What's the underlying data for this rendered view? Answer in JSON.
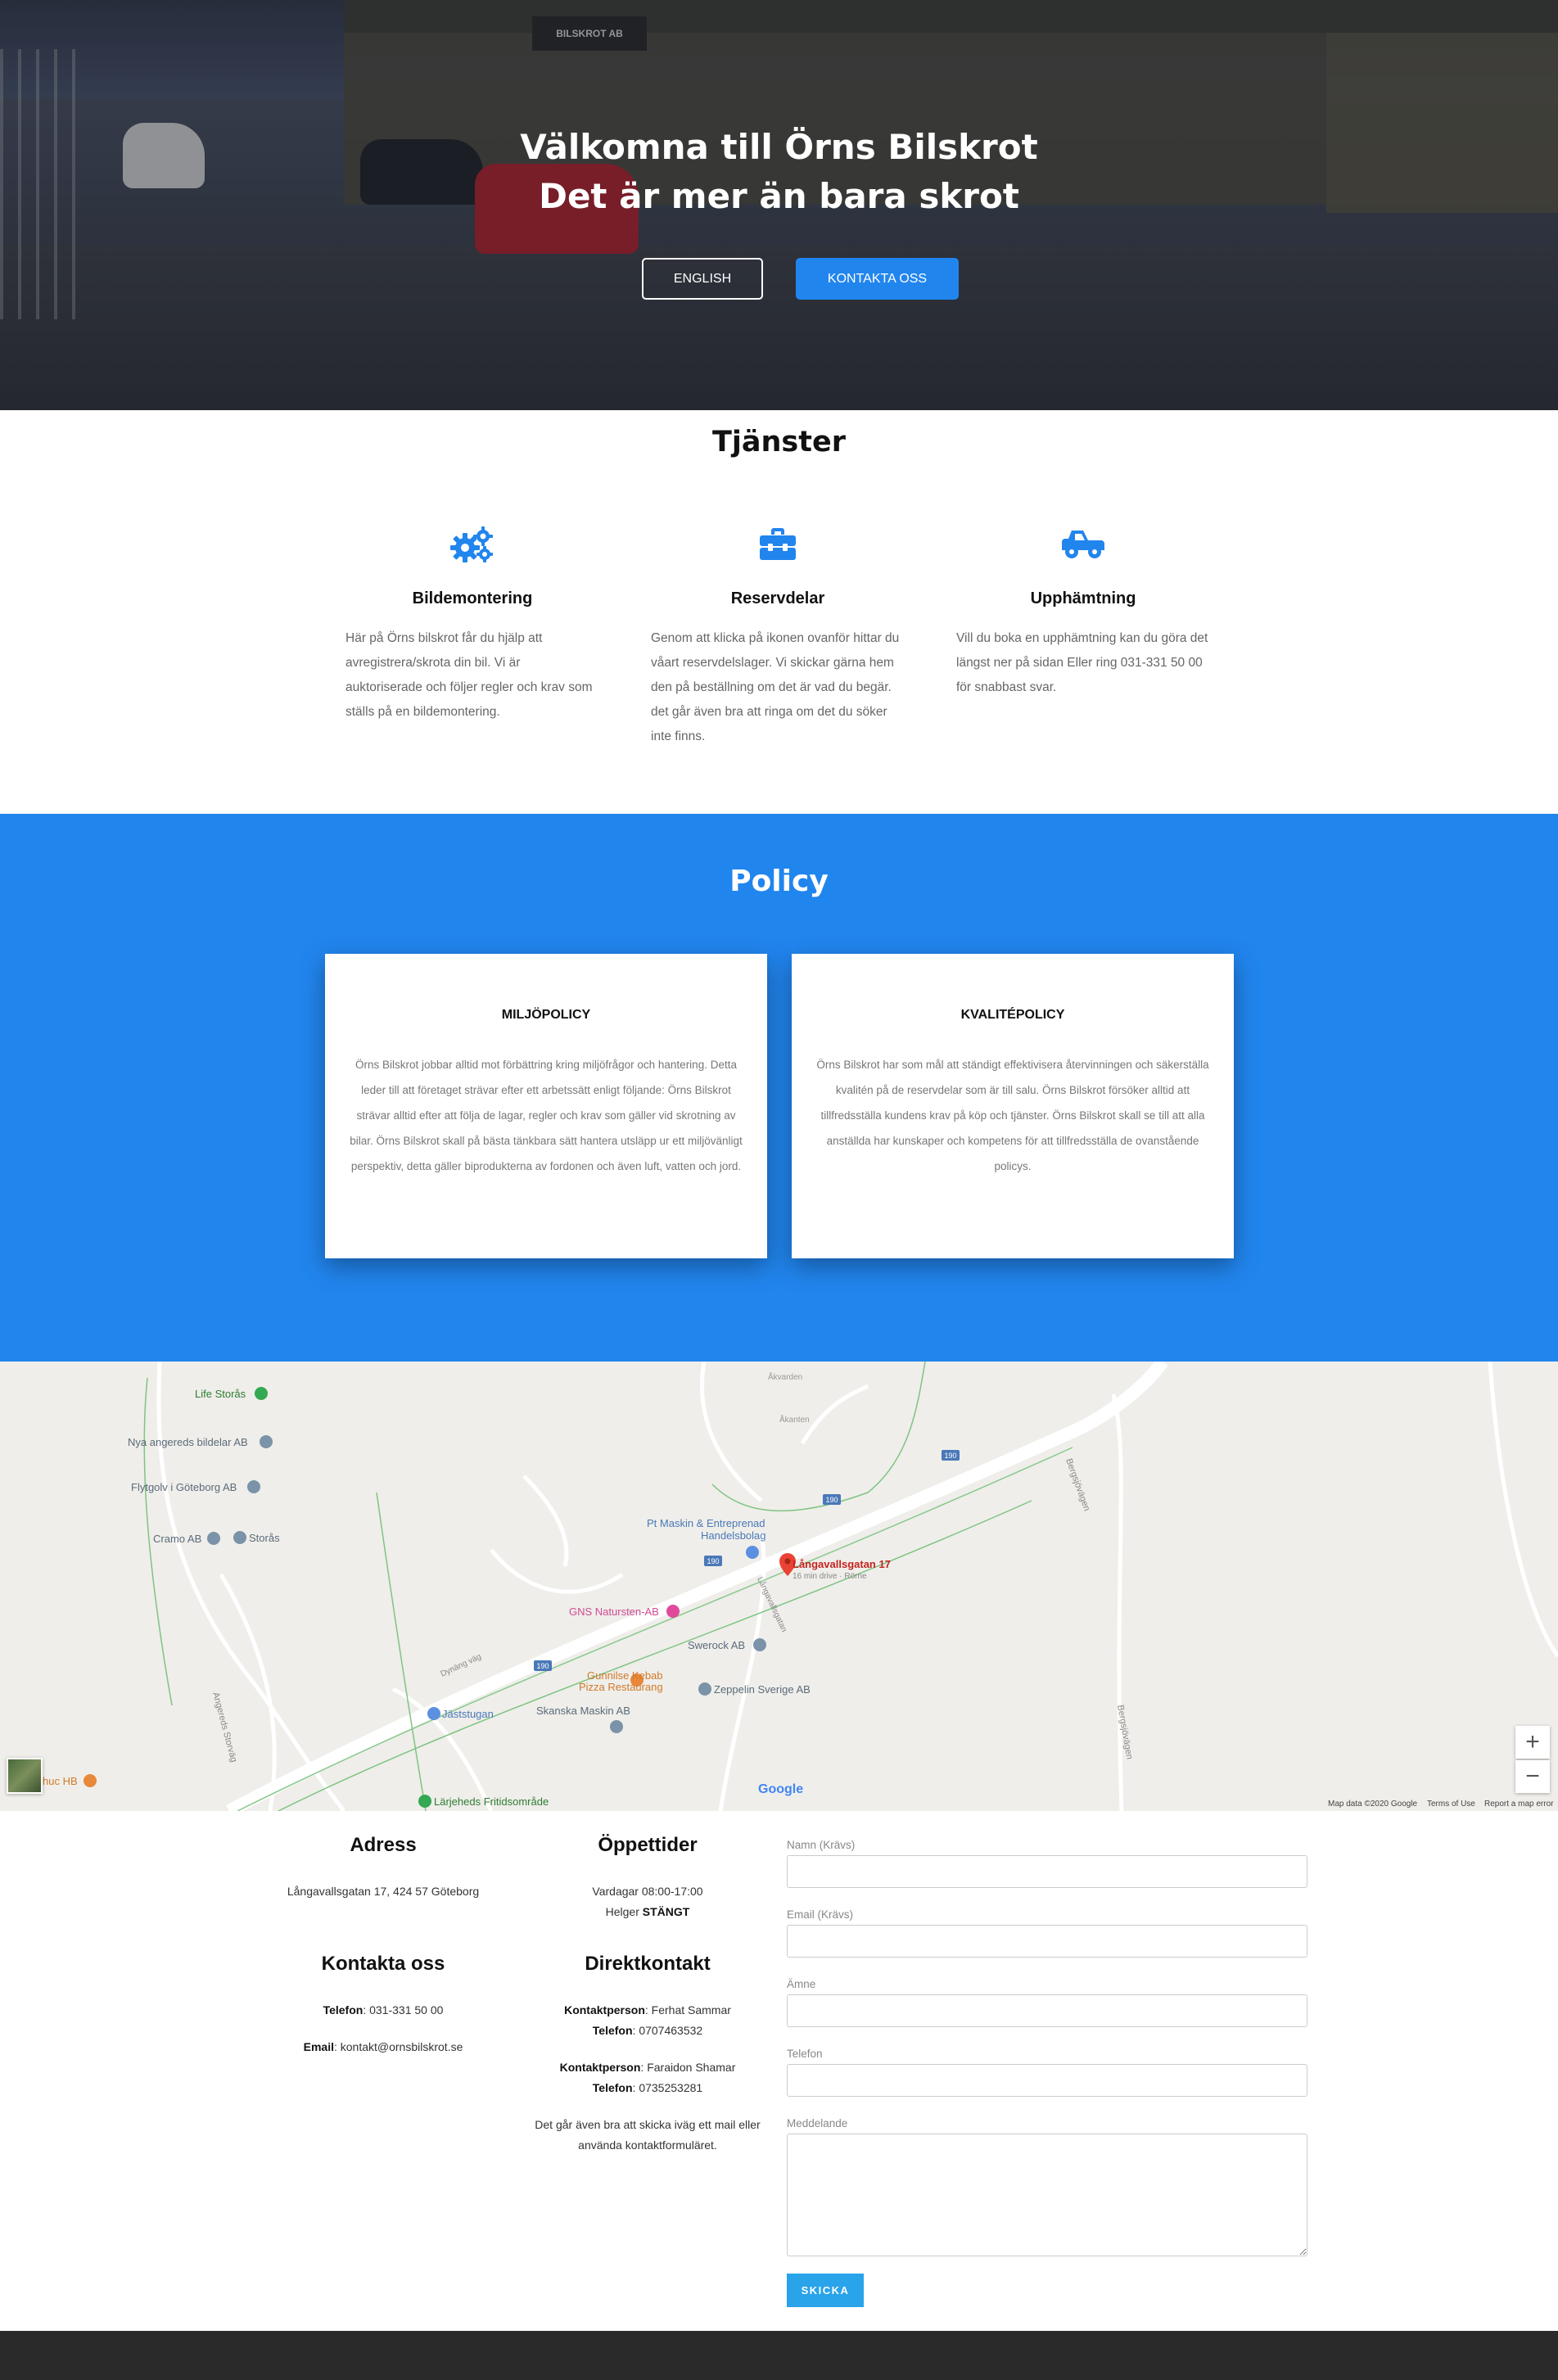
{
  "hero": {
    "title_line1": "Välkomna till Örns Bilskrot",
    "title_line2": "Det är mer än bara skrot",
    "english_label": "ENGLISH",
    "contact_label": "KONTAKTA OSS",
    "sign_text": "BILSKROT AB"
  },
  "services": {
    "title": "Tjänster",
    "items": [
      {
        "icon": "gears-icon",
        "title": "Bildemontering",
        "text": "Här på Örns bilskrot får du hjälp att avregistrera/skrota din bil. Vi är auktoriserade och följer regler och krav som ställs på en bildemontering."
      },
      {
        "icon": "toolbox-icon",
        "title": "Reservdelar",
        "text": "Genom att klicka på ikonen ovanför hittar du våart reservdelslager. Vi skickar gärna hem den på beställning om det är vad du begär. det går även bra att ringa om det du söker inte finns."
      },
      {
        "icon": "truck-icon",
        "title": "Upphämtning",
        "text": "Vill du boka en upphämtning kan du göra det längst ner på sidan Eller ring 031-331 50 00 för snabbast svar."
      }
    ]
  },
  "policy": {
    "title": "Policy",
    "cards": [
      {
        "title": "MILJÖPOLICY",
        "text": "Örns Bilskrot jobbar alltid mot förbättring kring miljöfrågor och hantering. Detta leder till att företaget strävar efter ett arbetssätt enligt följande: Örns Bilskrot strävar alltid efter att följa de lagar, regler och krav som gäller vid skrotning av bilar. Örns Bilskrot skall på bästa tänkbara sätt hantera utsläpp ur ett miljövänligt perspektiv, detta gäller biprodukterna av fordonen och även luft, vatten och jord."
      },
      {
        "title": "KVALITÉPOLICY",
        "text": "Örns Bilskrot har som mål att ständigt effektivisera återvinningen och säkerställa kvalitén på de reservdelar som är till salu. Örns Bilskrot försöker alltid att tillfredsställa kundens krav på köp och tjänster. Örns Bilskrot skall se till att alla anställda har kunskaper och kompetens för att tillfredsställa de ovanstående policys."
      }
    ]
  },
  "map": {
    "places": {
      "life_storas": "Life Storås",
      "nya_angereds": "Nya angereds bildelar AB",
      "flytgolv": "Flytgolv i Göteborg AB",
      "cramo": "Cramo AB",
      "storas": "Storås",
      "pt_maskin_1": "Pt Maskin & Entreprenad",
      "pt_maskin_2": "Handelsbolag",
      "pin_address": "Långavallsgatan 17",
      "pin_drive": "16 min drive · Rörne",
      "gns": "GNS Natursten-AB",
      "swerock": "Swerock AB",
      "gunnilse_1": "Gunnilse Kebab",
      "gunnilse_2": "Pizza Restaurang",
      "zeppelin": "Zeppelin Sverige AB",
      "skanska": "Skanska Maskin AB",
      "jaststugan": "Jäststugan",
      "larjeheds": "Lärjeheds Fritidsområde",
      "chuc": "huc HB",
      "akvarden": "Åkvarden",
      "akanten": "Åkanten",
      "route_190": "190"
    },
    "roads": {
      "bergsjovagen": "Bergsjövägen",
      "bergsjovagen2": "Bergsjövägen",
      "angereds_storvag": "Angereds Storväg",
      "langavallsgatan": "Långavallsgatan",
      "dynang_vag": "Dynäng väg"
    },
    "zoom_in": "+",
    "zoom_out": "−",
    "map_data": "Map data ©2020 Google",
    "terms": "Terms of Use",
    "report": "Report a map error",
    "google": "Google"
  },
  "contact": {
    "address_title": "Adress",
    "address_text": "Långavallsgatan 17, 424 57 Göteborg",
    "hours_title": "Öppettider",
    "hours_weekday": "Vardagar 08:00-17:00",
    "hours_weekend_label": "Helger",
    "hours_weekend_value": "STÄNGT",
    "kontakta_title": "Kontakta oss",
    "phone_label": "Telefon",
    "phone_value": ": 031-331 50 00",
    "email_label": "Email",
    "email_value": ": kontakt@ornsbilskrot.se",
    "direct_title": "Direktkontakt",
    "person1_label": "Kontaktperson",
    "person1_value": ": Ferhat Sammar",
    "person1_phone_label": "Telefon",
    "person1_phone_value": ": 0707463532",
    "person2_label": "Kontaktperson",
    "person2_value": ": Faraidon Shamar",
    "person2_phone_label": "Telefon",
    "person2_phone_value": ": 0735253281",
    "note_line1": "Det går även bra att skicka iväg ett mail eller",
    "note_line2": "använda kontaktformuläret."
  },
  "form": {
    "name_label": "Namn (Krävs)",
    "email_label": "Email (Krävs)",
    "subject_label": "Ämne",
    "phone_label": "Telefon",
    "message_label": "Meddelande",
    "submit_label": "SKICKA"
  },
  "colors": {
    "accent": "#2185ee",
    "submit": "#29a3ea",
    "footer": "#2a2a2a"
  }
}
